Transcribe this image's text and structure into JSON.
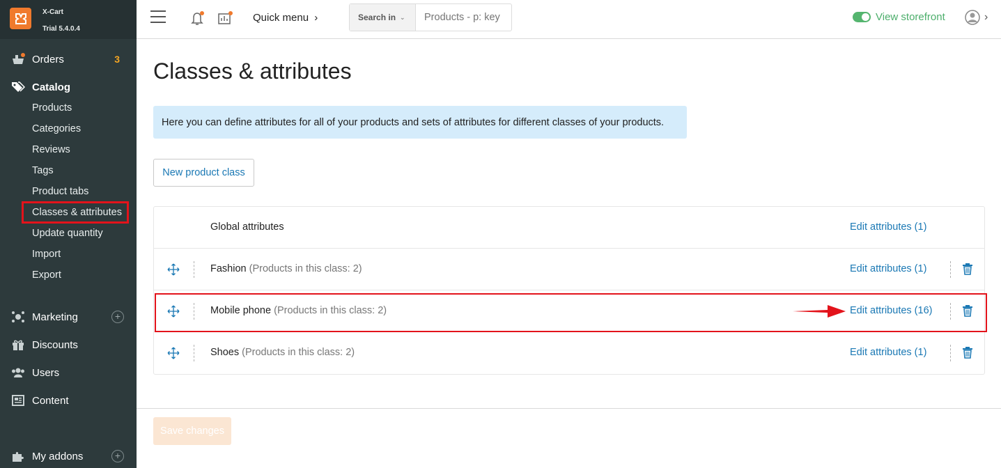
{
  "brand": {
    "name": "X-Cart",
    "version": "Trial 5.4.0.4"
  },
  "sidebar": {
    "orders": {
      "label": "Orders",
      "count": "3"
    },
    "catalog": {
      "label": "Catalog",
      "items": [
        "Products",
        "Categories",
        "Reviews",
        "Tags",
        "Product tabs",
        "Classes & attributes",
        "Update quantity",
        "Import",
        "Export"
      ]
    },
    "marketing": "Marketing",
    "discounts": "Discounts",
    "users": "Users",
    "content": "Content",
    "addons": "My addons"
  },
  "topbar": {
    "quick_menu": "Quick menu",
    "search_in": "Search in",
    "search_placeholder": "Products - p: key",
    "view_storefront": "View storefront"
  },
  "main": {
    "title": "Classes & attributes",
    "info": "Here you can define attributes for all of your products and sets of attributes for different classes of your products.",
    "new_class": "New product class",
    "rows": [
      {
        "name": "Global attributes",
        "count": "",
        "edit": "Edit attributes (1)"
      },
      {
        "name": "Fashion",
        "count": "(Products in this class: 2)",
        "edit": "Edit attributes (1)"
      },
      {
        "name": "Mobile phone",
        "count": "(Products in this class: 2)",
        "edit": "Edit attributes (16)"
      },
      {
        "name": "Shoes",
        "count": "(Products in this class: 2)",
        "edit": "Edit attributes (1)"
      }
    ],
    "save": "Save changes"
  },
  "colors": {
    "accent": "#1a78b4",
    "brand": "#f07a2d",
    "highlight": "#e3131b",
    "sidebar": "#2d3a3c"
  }
}
